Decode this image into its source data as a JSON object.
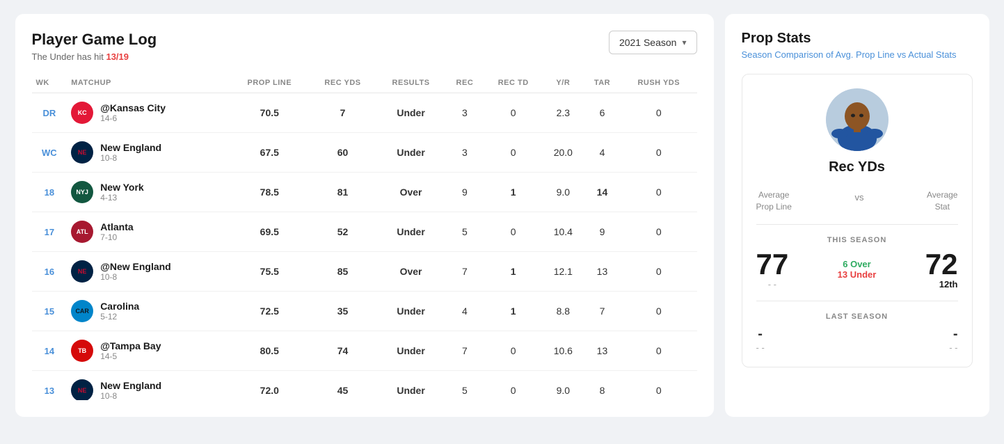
{
  "leftPanel": {
    "title": "Player Game Log",
    "underHitText": "The Under has hit",
    "underHitValue": "13/19",
    "seasonSelector": "2021 Season",
    "columns": [
      "WK",
      "MATCHUP",
      "PROP LINE",
      "REC YDS",
      "RESULTS",
      "REC",
      "REC TD",
      "Y/R",
      "TAR",
      "RUSH YDS"
    ],
    "rows": [
      {
        "wk": "DR",
        "opponent": "@Kansas City",
        "record": "14-6",
        "logoClass": "logo-kc",
        "logoText": "KC",
        "propLine": "70.5",
        "recYds": "7",
        "result": "Under",
        "rec": "3",
        "recTd": "0",
        "yr": "2.3",
        "tar": "6",
        "rushYds": "0"
      },
      {
        "wk": "WC",
        "opponent": "New England",
        "record": "10-8",
        "logoClass": "logo-ne",
        "logoText": "NE",
        "propLine": "67.5",
        "recYds": "60",
        "result": "Under",
        "rec": "3",
        "recTd": "0",
        "yr": "20.0",
        "tar": "4",
        "rushYds": "0"
      },
      {
        "wk": "18",
        "opponent": "New York",
        "record": "4-13",
        "logoClass": "logo-nyj",
        "logoText": "NYJ",
        "propLine": "78.5",
        "recYds": "81",
        "result": "Over",
        "rec": "9",
        "recTd": "1",
        "yr": "9.0",
        "tar": "14",
        "rushYds": "0"
      },
      {
        "wk": "17",
        "opponent": "Atlanta",
        "record": "7-10",
        "logoClass": "logo-atl",
        "logoText": "ATL",
        "propLine": "69.5",
        "recYds": "52",
        "result": "Under",
        "rec": "5",
        "recTd": "0",
        "yr": "10.4",
        "tar": "9",
        "rushYds": "0"
      },
      {
        "wk": "16",
        "opponent": "@New England",
        "record": "10-8",
        "logoClass": "logo-ne2",
        "logoText": "NE",
        "propLine": "75.5",
        "recYds": "85",
        "result": "Over",
        "rec": "7",
        "recTd": "1",
        "yr": "12.1",
        "tar": "13",
        "rushYds": "0"
      },
      {
        "wk": "15",
        "opponent": "Carolina",
        "record": "5-12",
        "logoClass": "logo-car",
        "logoText": "CAR",
        "propLine": "72.5",
        "recYds": "35",
        "result": "Under",
        "rec": "4",
        "recTd": "1",
        "yr": "8.8",
        "tar": "7",
        "rushYds": "0"
      },
      {
        "wk": "14",
        "opponent": "@Tampa Bay",
        "record": "14-5",
        "logoClass": "logo-tb",
        "logoText": "TB",
        "propLine": "80.5",
        "recYds": "74",
        "result": "Under",
        "rec": "7",
        "recTd": "0",
        "yr": "10.6",
        "tar": "13",
        "rushYds": "0"
      },
      {
        "wk": "13",
        "opponent": "New England",
        "record": "10-8",
        "logoClass": "logo-ne",
        "logoText": "NE",
        "propLine": "72.0",
        "recYds": "45",
        "result": "Under",
        "rec": "5",
        "recTd": "0",
        "yr": "9.0",
        "tar": "8",
        "rushYds": "0"
      }
    ]
  },
  "rightPanel": {
    "title": "Prop Stats",
    "subtitle": "Season Comparison of Avg. Prop Line vs Actual Stats",
    "statName": "Rec YDs",
    "avgPropLabel": "Average\nProp Line",
    "vsLabel": "vs",
    "avgStatLabel": "Average\nStat",
    "thisSeasonLabel": "THIS SEASON",
    "avgPropValue": "77",
    "avgPropDash": "- -",
    "overCount": "6 Over",
    "underCount": "13 Under",
    "avgStatValue": "72",
    "avgStatRank": "12th",
    "lastSeasonLabel": "LAST SEASON",
    "lastSeasonProp": "-",
    "lastSeasonPropDash": "- -",
    "lastSeasonStat": "-",
    "lastSeasonStatDash": "- -"
  }
}
